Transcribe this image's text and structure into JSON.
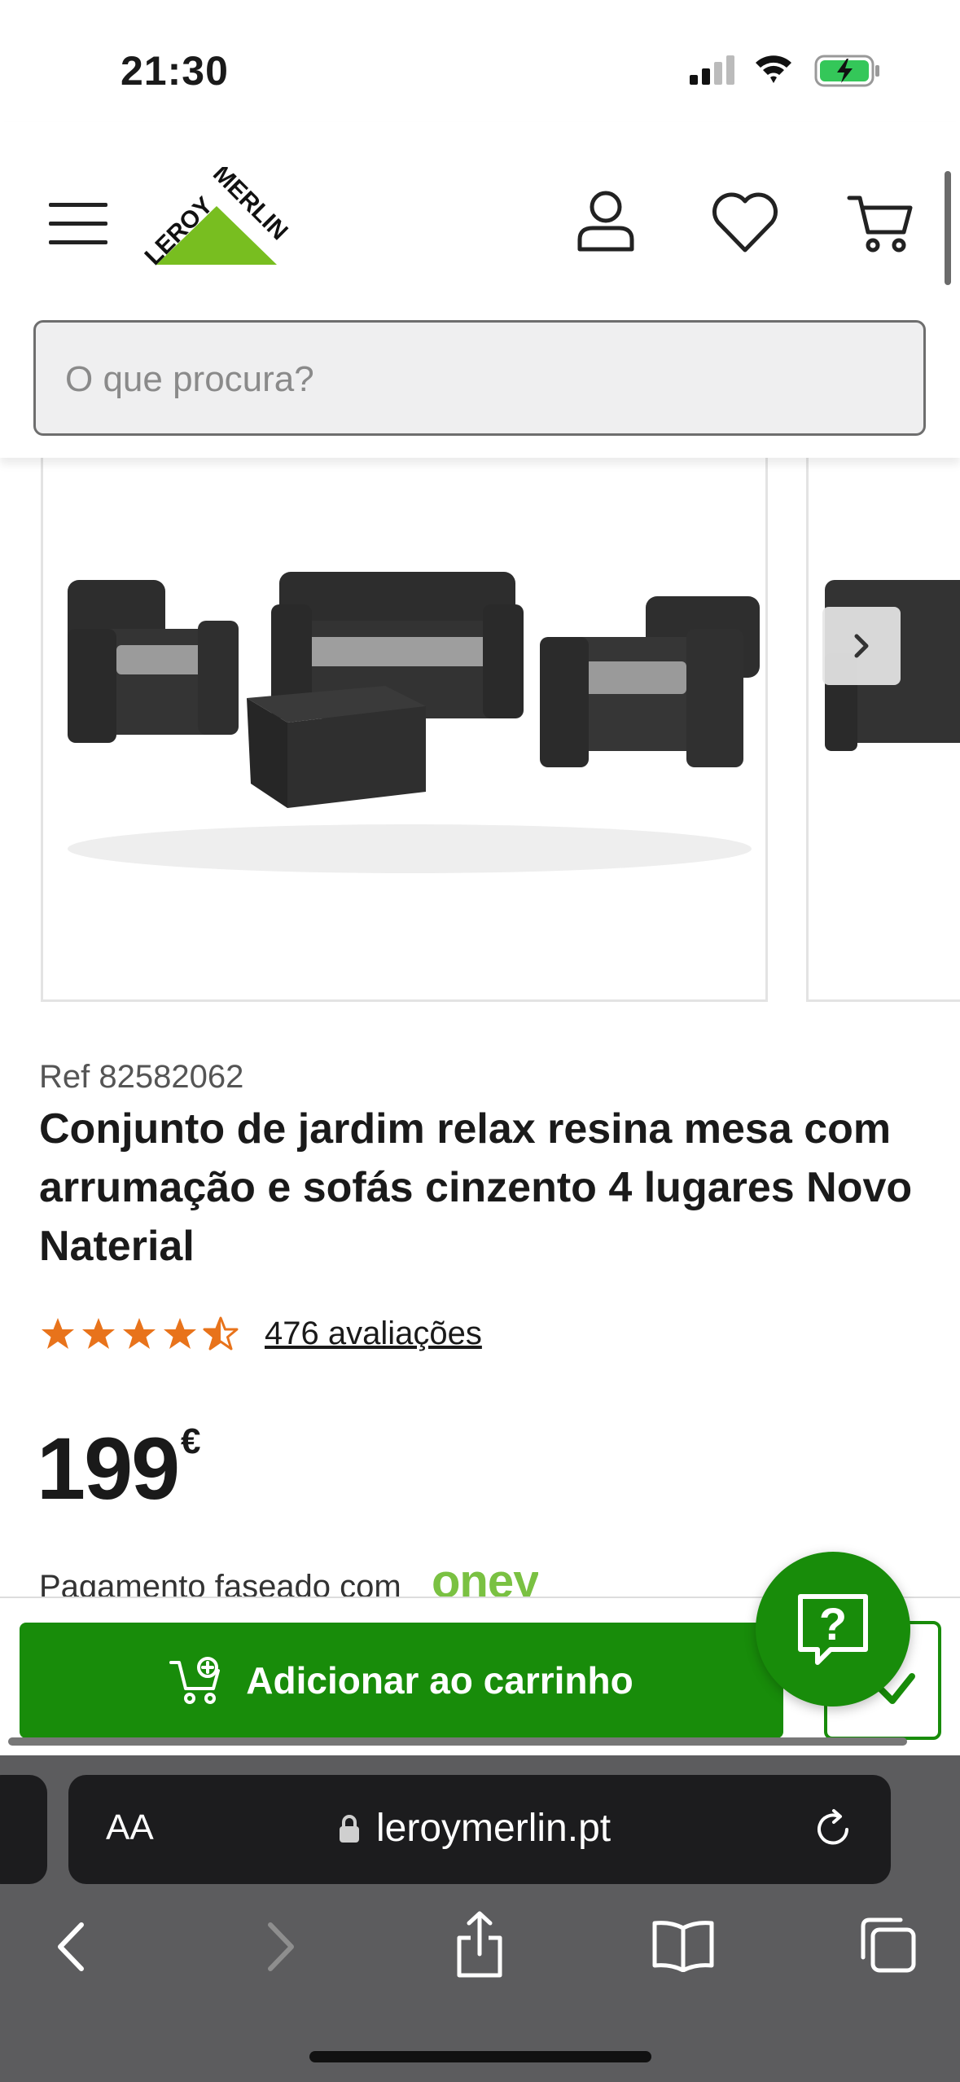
{
  "status_bar": {
    "time": "21:30",
    "icons": [
      "signal-icon",
      "wifi-icon",
      "battery-charging-icon"
    ]
  },
  "header": {
    "logo_text": "LEROY MERLIN",
    "icons": [
      "menu-icon",
      "user-icon",
      "heart-icon",
      "cart-icon"
    ],
    "brand_color": "#78be20"
  },
  "search": {
    "placeholder": "O que procura?"
  },
  "gallery": {
    "image_alt": "Conjunto de jardim relax resina",
    "next_icon": "chevron-right-icon"
  },
  "product": {
    "ref": "Ref 82582062",
    "title": "Conjunto de jardim relax resina mesa com arrumação e sofás cinzento 4 lugares Novo Naterial",
    "rating": 4.5,
    "rating_max": 5,
    "reviews": "476 avaliações",
    "price": "199",
    "currency": "€",
    "payment_text": "Pagamento faseado com",
    "payment_brand": "oney"
  },
  "actions": {
    "add_to_cart": "Adicionar ao carrinho",
    "accent": "#188c0a"
  },
  "browser": {
    "aa_label": "AA",
    "url": "leroymerlin.pt"
  }
}
